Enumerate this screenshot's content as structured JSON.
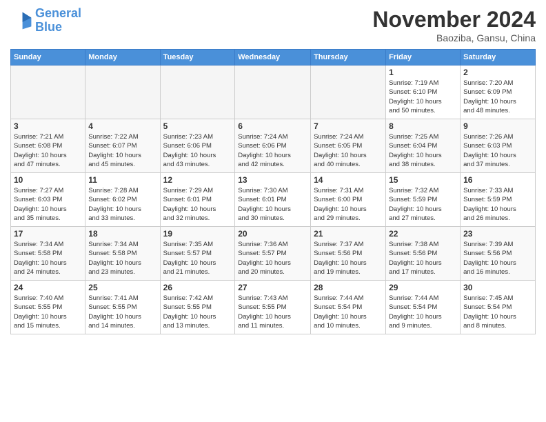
{
  "header": {
    "logo_line1": "General",
    "logo_line2": "Blue",
    "month": "November 2024",
    "location": "Baoziba, Gansu, China"
  },
  "days_of_week": [
    "Sunday",
    "Monday",
    "Tuesday",
    "Wednesday",
    "Thursday",
    "Friday",
    "Saturday"
  ],
  "weeks": [
    [
      {
        "day": "",
        "info": ""
      },
      {
        "day": "",
        "info": ""
      },
      {
        "day": "",
        "info": ""
      },
      {
        "day": "",
        "info": ""
      },
      {
        "day": "",
        "info": ""
      },
      {
        "day": "1",
        "info": "Sunrise: 7:19 AM\nSunset: 6:10 PM\nDaylight: 10 hours\nand 50 minutes."
      },
      {
        "day": "2",
        "info": "Sunrise: 7:20 AM\nSunset: 6:09 PM\nDaylight: 10 hours\nand 48 minutes."
      }
    ],
    [
      {
        "day": "3",
        "info": "Sunrise: 7:21 AM\nSunset: 6:08 PM\nDaylight: 10 hours\nand 47 minutes."
      },
      {
        "day": "4",
        "info": "Sunrise: 7:22 AM\nSunset: 6:07 PM\nDaylight: 10 hours\nand 45 minutes."
      },
      {
        "day": "5",
        "info": "Sunrise: 7:23 AM\nSunset: 6:06 PM\nDaylight: 10 hours\nand 43 minutes."
      },
      {
        "day": "6",
        "info": "Sunrise: 7:24 AM\nSunset: 6:06 PM\nDaylight: 10 hours\nand 42 minutes."
      },
      {
        "day": "7",
        "info": "Sunrise: 7:24 AM\nSunset: 6:05 PM\nDaylight: 10 hours\nand 40 minutes."
      },
      {
        "day": "8",
        "info": "Sunrise: 7:25 AM\nSunset: 6:04 PM\nDaylight: 10 hours\nand 38 minutes."
      },
      {
        "day": "9",
        "info": "Sunrise: 7:26 AM\nSunset: 6:03 PM\nDaylight: 10 hours\nand 37 minutes."
      }
    ],
    [
      {
        "day": "10",
        "info": "Sunrise: 7:27 AM\nSunset: 6:03 PM\nDaylight: 10 hours\nand 35 minutes."
      },
      {
        "day": "11",
        "info": "Sunrise: 7:28 AM\nSunset: 6:02 PM\nDaylight: 10 hours\nand 33 minutes."
      },
      {
        "day": "12",
        "info": "Sunrise: 7:29 AM\nSunset: 6:01 PM\nDaylight: 10 hours\nand 32 minutes."
      },
      {
        "day": "13",
        "info": "Sunrise: 7:30 AM\nSunset: 6:01 PM\nDaylight: 10 hours\nand 30 minutes."
      },
      {
        "day": "14",
        "info": "Sunrise: 7:31 AM\nSunset: 6:00 PM\nDaylight: 10 hours\nand 29 minutes."
      },
      {
        "day": "15",
        "info": "Sunrise: 7:32 AM\nSunset: 5:59 PM\nDaylight: 10 hours\nand 27 minutes."
      },
      {
        "day": "16",
        "info": "Sunrise: 7:33 AM\nSunset: 5:59 PM\nDaylight: 10 hours\nand 26 minutes."
      }
    ],
    [
      {
        "day": "17",
        "info": "Sunrise: 7:34 AM\nSunset: 5:58 PM\nDaylight: 10 hours\nand 24 minutes."
      },
      {
        "day": "18",
        "info": "Sunrise: 7:34 AM\nSunset: 5:58 PM\nDaylight: 10 hours\nand 23 minutes."
      },
      {
        "day": "19",
        "info": "Sunrise: 7:35 AM\nSunset: 5:57 PM\nDaylight: 10 hours\nand 21 minutes."
      },
      {
        "day": "20",
        "info": "Sunrise: 7:36 AM\nSunset: 5:57 PM\nDaylight: 10 hours\nand 20 minutes."
      },
      {
        "day": "21",
        "info": "Sunrise: 7:37 AM\nSunset: 5:56 PM\nDaylight: 10 hours\nand 19 minutes."
      },
      {
        "day": "22",
        "info": "Sunrise: 7:38 AM\nSunset: 5:56 PM\nDaylight: 10 hours\nand 17 minutes."
      },
      {
        "day": "23",
        "info": "Sunrise: 7:39 AM\nSunset: 5:56 PM\nDaylight: 10 hours\nand 16 minutes."
      }
    ],
    [
      {
        "day": "24",
        "info": "Sunrise: 7:40 AM\nSunset: 5:55 PM\nDaylight: 10 hours\nand 15 minutes."
      },
      {
        "day": "25",
        "info": "Sunrise: 7:41 AM\nSunset: 5:55 PM\nDaylight: 10 hours\nand 14 minutes."
      },
      {
        "day": "26",
        "info": "Sunrise: 7:42 AM\nSunset: 5:55 PM\nDaylight: 10 hours\nand 13 minutes."
      },
      {
        "day": "27",
        "info": "Sunrise: 7:43 AM\nSunset: 5:55 PM\nDaylight: 10 hours\nand 11 minutes."
      },
      {
        "day": "28",
        "info": "Sunrise: 7:44 AM\nSunset: 5:54 PM\nDaylight: 10 hours\nand 10 minutes."
      },
      {
        "day": "29",
        "info": "Sunrise: 7:44 AM\nSunset: 5:54 PM\nDaylight: 10 hours\nand 9 minutes."
      },
      {
        "day": "30",
        "info": "Sunrise: 7:45 AM\nSunset: 5:54 PM\nDaylight: 10 hours\nand 8 minutes."
      }
    ]
  ]
}
